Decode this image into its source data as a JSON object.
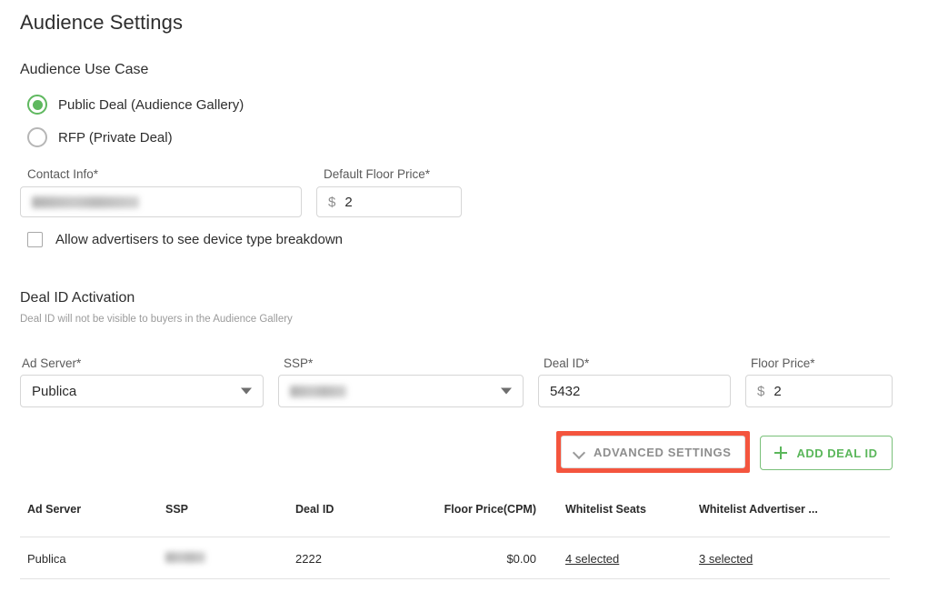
{
  "page_title": "Audience Settings",
  "use_case": {
    "title": "Audience Use Case",
    "options": [
      {
        "label": "Public Deal (Audience Gallery)",
        "selected": true
      },
      {
        "label": "RFP (Private Deal)",
        "selected": false
      }
    ]
  },
  "contact": {
    "label": "Contact Info",
    "required_mark": "*",
    "value": "",
    "redacted": true
  },
  "default_floor_price": {
    "label": "Default Floor Price",
    "required_mark": "*",
    "currency": "$",
    "value": "2"
  },
  "allow_device_breakdown": {
    "label": "Allow advertisers to see device type breakdown",
    "checked": false
  },
  "activation": {
    "title": "Deal ID Activation",
    "subtitle": "Deal ID will not be visible to buyers in the Audience Gallery",
    "ad_server": {
      "label": "Ad Server",
      "required_mark": "*",
      "value": "Publica",
      "caret_icon": "chevron-down-icon"
    },
    "ssp": {
      "label": "SSP",
      "required_mark": "*",
      "value": "",
      "redacted": true,
      "caret_icon": "chevron-down-icon"
    },
    "deal_id": {
      "label": "Deal ID",
      "required_mark": "*",
      "value": "5432"
    },
    "floor_price": {
      "label": "Floor Price",
      "required_mark": "*",
      "currency": "$",
      "value": "2"
    }
  },
  "buttons": {
    "advanced_settings": {
      "label": "ADVANCED SETTINGS",
      "icon": "chevron-down-icon",
      "highlighted": true,
      "highlight_color": "#f4553e"
    },
    "add_deal_id": {
      "label": "ADD DEAL ID",
      "icon": "plus-icon",
      "accent_color": "#5bb75b"
    }
  },
  "table": {
    "columns": [
      "Ad Server",
      "SSP",
      "Deal ID",
      "Floor Price(CPM)",
      "Whitelist Seats",
      "Whitelist Advertiser ..."
    ],
    "rows": [
      {
        "ad_server": "Publica",
        "ssp": "",
        "ssp_redacted": true,
        "deal_id": "2222",
        "floor_price": "$0.00",
        "whitelist_seats": "4 selected",
        "whitelist_advertisers": "3 selected"
      }
    ]
  },
  "colors": {
    "radio_green": "#5fb85f",
    "link_blue": "#1656d6",
    "highlight_red": "#f4553e",
    "button_green": "#5bb75b"
  }
}
